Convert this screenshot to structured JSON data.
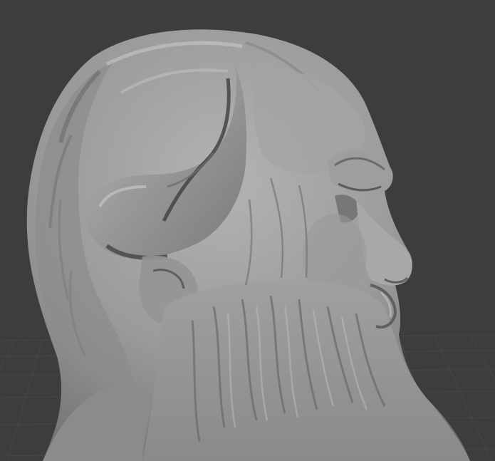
{
  "viewport": {
    "background_color": "#3d3d3d",
    "grid_line_color": "#474747",
    "mesh_base_color": "#8f8f8f",
    "mesh_highlight_color": "#b8b8b8",
    "mesh_shadow_color": "#4a4a4a"
  },
  "model": {
    "icon": "sculpted-bust-mesh"
  }
}
